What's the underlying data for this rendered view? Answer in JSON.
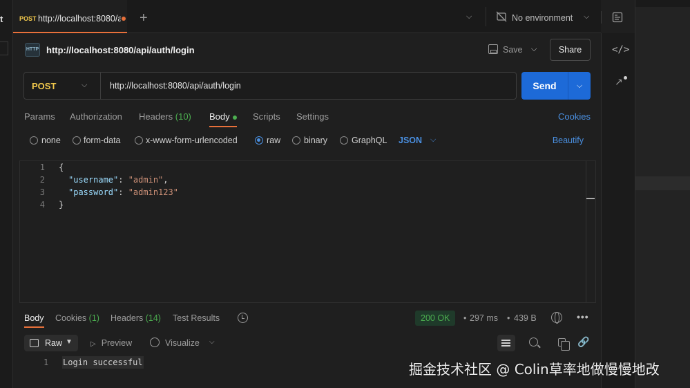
{
  "left_edge": {
    "fragment": "t"
  },
  "tabbar": {
    "tab": {
      "method": "POST",
      "url": "http://localhost:8080/a"
    }
  },
  "environment": {
    "label": "No environment"
  },
  "request": {
    "title": "http://localhost:8080/api/auth/login",
    "save_label": "Save",
    "share_label": "Share",
    "method": "POST",
    "url": "http://localhost:8080/api/auth/login",
    "send_label": "Send"
  },
  "request_tabs": {
    "params": "Params",
    "authorization": "Authorization",
    "headers": "Headers",
    "headers_count": "(10)",
    "body": "Body",
    "scripts": "Scripts",
    "settings": "Settings",
    "cookies": "Cookies"
  },
  "body_options": {
    "none": "none",
    "form_data": "form-data",
    "urlencoded": "x-www-form-urlencoded",
    "raw": "raw",
    "binary": "binary",
    "graphql": "GraphQL",
    "format": "JSON",
    "beautify": "Beautify",
    "selected": "raw"
  },
  "editor": {
    "line_numbers": [
      "1",
      "2",
      "3",
      "4"
    ],
    "lines": {
      "l1": "{",
      "l2_key": "\"username\"",
      "l2_sep": ": ",
      "l2_val": "\"admin\"",
      "l2_end": ",",
      "l3_key": "\"password\"",
      "l3_sep": ": ",
      "l3_val": "\"admin123\"",
      "l4": "}"
    }
  },
  "response_tabs": {
    "body": "Body",
    "cookies": "Cookies",
    "cookies_count": "(1)",
    "headers": "Headers",
    "headers_count": "(14)",
    "test_results": "Test Results",
    "status": "200 OK",
    "time": "297 ms",
    "size": "439 B",
    "bullet": "•"
  },
  "response_tools": {
    "raw": "Raw",
    "preview": "Preview",
    "visualize": "Visualize"
  },
  "response_body": {
    "line_number": "1",
    "text": "Login successful"
  },
  "watermark": "掘金技术社区 @ Colin草率地做慢慢地改",
  "colors": {
    "accent_orange": "#e8703a",
    "method_post": "#f2c94c",
    "send_blue": "#1d6ad8",
    "link_blue": "#4a90e2",
    "success_green": "#4caf50"
  }
}
